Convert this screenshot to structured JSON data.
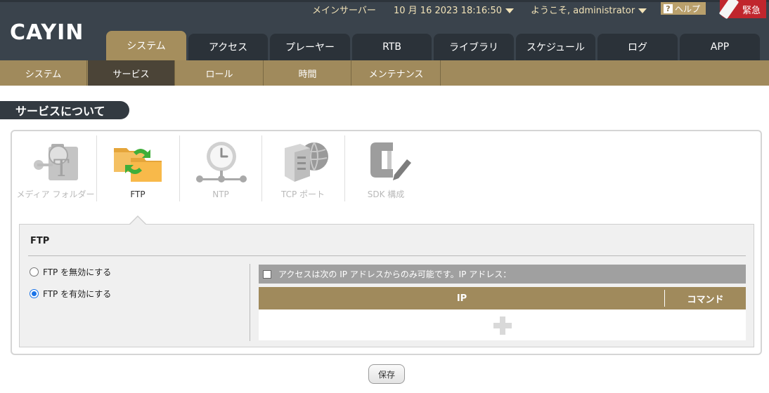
{
  "header": {
    "logo_text": "CAYIN",
    "server_label": "メインサーバー",
    "datetime": "10 月 16 2023 18:16:50",
    "welcome": "ようこそ, administrator",
    "help_label": "ヘルプ",
    "emergency_label": "緊急"
  },
  "main_tabs": [
    {
      "label": "システム",
      "active": true
    },
    {
      "label": "アクセス"
    },
    {
      "label": "プレーヤー"
    },
    {
      "label": "RTB"
    },
    {
      "label": "ライブラリ"
    },
    {
      "label": "スケジュール"
    },
    {
      "label": "ログ"
    },
    {
      "label": "APP"
    }
  ],
  "sub_tabs": [
    {
      "label": "システム"
    },
    {
      "label": "サービス",
      "active": true
    },
    {
      "label": "ロール"
    },
    {
      "label": "時間"
    },
    {
      "label": "メンテナンス"
    }
  ],
  "section_title": "サービスについて",
  "services": [
    {
      "label": "メディア フォルダー",
      "icon": "media-folder-icon"
    },
    {
      "label": "FTP",
      "icon": "ftp-folders-icon",
      "active": true
    },
    {
      "label": "NTP",
      "icon": "clock-network-icon"
    },
    {
      "label": "TCP ポート",
      "icon": "server-globe-icon"
    },
    {
      "label": "SDK 構成",
      "icon": "clamp-pen-icon"
    }
  ],
  "ftp": {
    "title": "FTP",
    "disable_label": "FTP を無効にする",
    "enable_label": "FTP を有効にする",
    "enabled": true,
    "ip_restrict_label": "アクセスは次の IP アドレスからのみ可能です。IP アドレス：",
    "col_ip": "IP",
    "col_command": "コマンド"
  },
  "save_label": "保存",
  "colors": {
    "header_bg": "#3a434c",
    "accent_gold": "#a08a5c",
    "status_text": "#f1e2b7",
    "emergency_red": "#c0262d"
  }
}
